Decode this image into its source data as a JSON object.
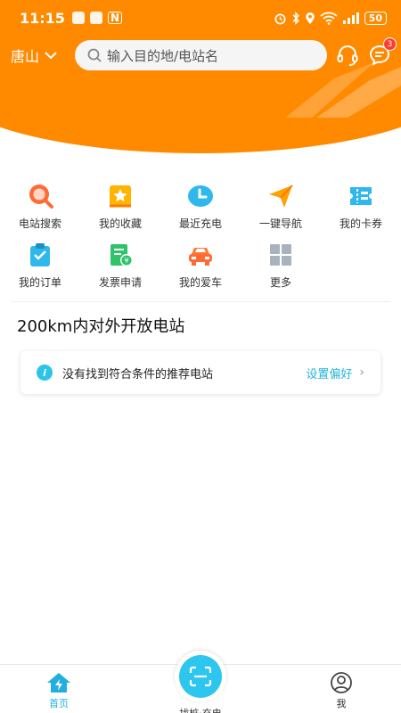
{
  "status_bar": {
    "time": "11:15",
    "battery": "50",
    "left_icons": [
      "map-nav-icon",
      "voice-icon",
      "nfc-icon"
    ],
    "right_icons": [
      "alarm-icon",
      "bluetooth-icon",
      "location-icon",
      "wifi-icon",
      "signal-icon",
      "battery-icon"
    ]
  },
  "header": {
    "city": "唐山",
    "search_placeholder": "输入目的地/电站名",
    "message_badge": "3",
    "accent_color": "#ff8a00"
  },
  "quick_menu": {
    "row1": [
      {
        "label": "电站搜索",
        "icon": "station-search-icon"
      },
      {
        "label": "我的收藏",
        "icon": "favorite-star-icon"
      },
      {
        "label": "最近充电",
        "icon": "recent-clock-icon"
      },
      {
        "label": "一键导航",
        "icon": "navigation-arrow-icon"
      },
      {
        "label": "我的卡券",
        "icon": "coupon-icon"
      }
    ],
    "row2": [
      {
        "label": "我的订单",
        "icon": "order-clipboard-icon"
      },
      {
        "label": "发票申请",
        "icon": "invoice-icon"
      },
      {
        "label": "我的爱车",
        "icon": "car-icon"
      },
      {
        "label": "更多",
        "icon": "more-grid-icon"
      }
    ]
  },
  "section": {
    "title": "200km内对外开放电站"
  },
  "empty_card": {
    "message": "没有找到符合条件的推荐电站",
    "action": "设置偏好"
  },
  "bottom_nav": {
    "home": "首页",
    "charge": "找桩·充电",
    "me": "我",
    "active_color": "#21aee0"
  }
}
